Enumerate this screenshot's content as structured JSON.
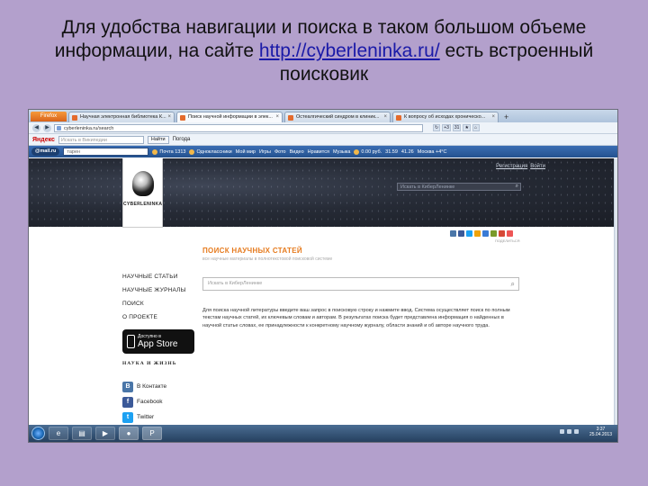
{
  "slide": {
    "title_line1": "Для удобства навигации и поиска в таком большом объеме",
    "title_line2_pre": "информации, на сайте ",
    "title_link": "http://cyberleninka.ru/",
    "title_line2_post": " есть встроенный",
    "title_line3": "поисковик"
  },
  "browser": {
    "app_button": "Firefox",
    "tabs": [
      {
        "label": "Научная электронная библиотека К..."
      },
      {
        "label": "Поиск научной информации в элек..."
      },
      {
        "label": "Остеалгический синдром в клиник..."
      },
      {
        "label": "К вопросу об исходах хроническо..."
      }
    ],
    "new_tab": "+",
    "url": "cyberleninka.ru/search",
    "nav_extras": [
      "+3",
      "31"
    ]
  },
  "yandex_bar": {
    "logo": "Яндекс",
    "placeholder": "Искать в Википедии",
    "find_button": "Найти",
    "weather": "Погода"
  },
  "mail_bar": {
    "logo": "@mail.ru",
    "search_value": "тарен",
    "items": [
      "Почта 1313",
      "Одноклассники",
      "Мой мир",
      "Игры",
      "Фото",
      "Видео",
      "Нравится",
      "Музыка",
      "0.00 руб.",
      "31.59",
      "41.26",
      "Москва +4°C"
    ]
  },
  "site": {
    "header_links": [
      "Регистрация",
      "Войти"
    ],
    "header_search_placeholder": "Искать в КиберЛенинке",
    "logo_text": "CYBERLENINKA",
    "nav": [
      "НАУЧНЫЕ СТАТЬИ",
      "НАУЧНЫЕ ЖУРНАЛЫ",
      "ПОИСК",
      "О ПРОЕКТЕ"
    ],
    "appstore_small": "Доступно в",
    "appstore_big": "App Store",
    "partner": "НАУКА И ЖИЗНЬ",
    "social": [
      "В Контакте",
      "Facebook",
      "Twitter"
    ],
    "share_label": "ПОДЕЛИТЬСЯ",
    "page_title": "ПОИСК НАУЧНЫХ СТАТЕЙ",
    "page_subtitle": "все научные материалы в полнотекстовой поисковой системе",
    "search_placeholder": "Искать в КиберЛенинке",
    "description": "Для поиска научной литературы введите ваш запрос в поисковую строку и нажмите ввод. Система осуществляет поиск по полным текстам научных статей, их ключевым словам и авторам. В результатах поиска будет представлена информация о найденных в научной статье словах, ее принадлежности к конкретному научному журналу, области знаний и об авторе научного труда."
  },
  "taskbar": {
    "time": "3:37",
    "date": "25.04.2013"
  },
  "colors": {
    "slide_bg": "#b3a0cc",
    "accent_orange": "#e67b1e",
    "link_blue": "#1a1aa8"
  }
}
